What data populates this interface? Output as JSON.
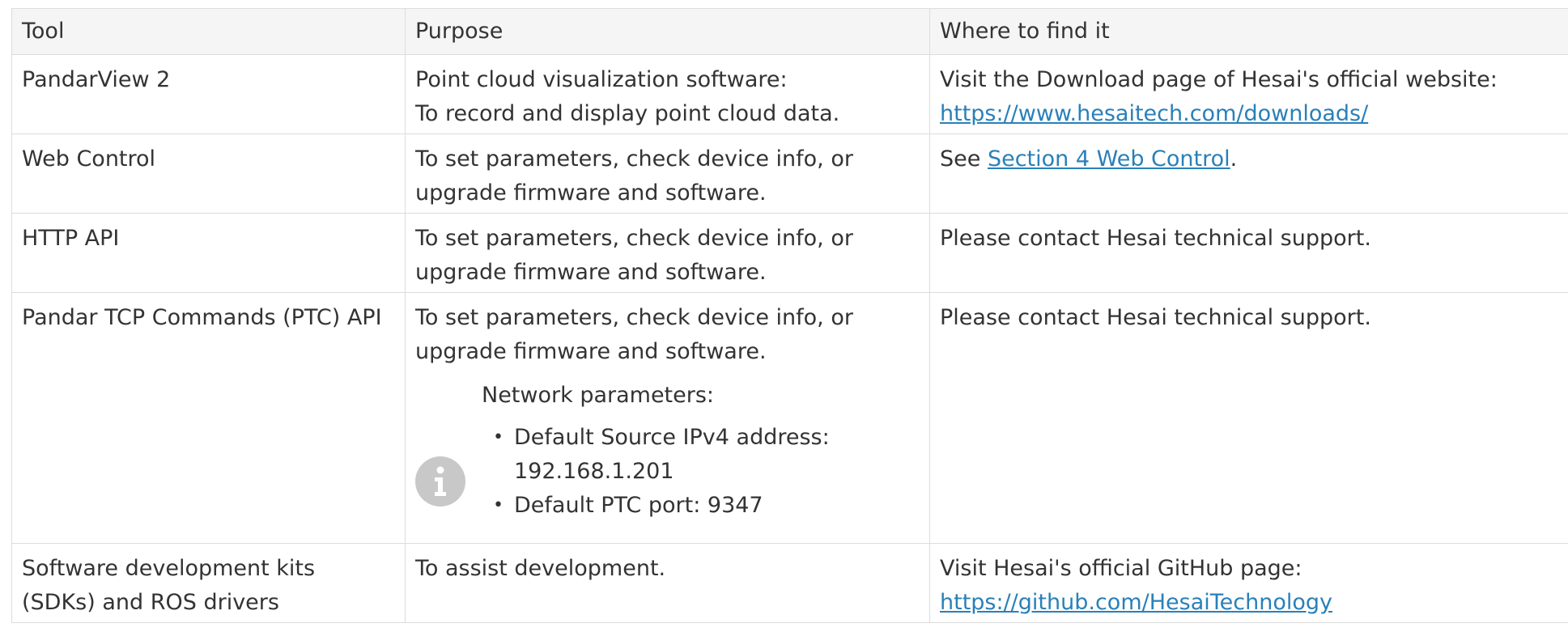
{
  "table": {
    "headers": [
      "Tool",
      "Purpose",
      "Where to find it"
    ],
    "rows": [
      {
        "tool": "PandarView 2",
        "purpose_lines": [
          "Point cloud visualization software:",
          "To record and display point cloud data."
        ],
        "where_text": "Visit the Download page of Hesai's official website:",
        "where_link": "https://www.hesaitech.com/downloads/"
      },
      {
        "tool": "Web Control",
        "purpose": "To set parameters, check device info, or upgrade firmware and software.",
        "where_prefix": "See ",
        "where_link": "Section 4 Web Control",
        "where_suffix": "."
      },
      {
        "tool": "HTTP API",
        "purpose": "To set parameters, check device info, or upgrade firmware and software.",
        "where": "Please contact Hesai technical support."
      },
      {
        "tool": "Pandar TCP Commands (PTC) API",
        "purpose": "To set parameters, check device info, or upgrade firmware and software.",
        "note": {
          "icon": "info-icon",
          "title": "Network parameters:",
          "items": [
            "Default Source IPv4 address: 192.168.1.201",
            "Default PTC port: 9347"
          ]
        },
        "where": "Please contact Hesai technical support."
      },
      {
        "tool": "Software development kits (SDKs) and ROS drivers",
        "purpose": "To assist development.",
        "where_text": "Visit Hesai's official GitHub page: ",
        "where_link": "https://github.com/HesaiTechnology"
      }
    ]
  },
  "colors": {
    "link": "#2980b9",
    "border": "#dcdcdc",
    "header_bg": "#f5f5f5",
    "icon": "#c8c8c8"
  }
}
